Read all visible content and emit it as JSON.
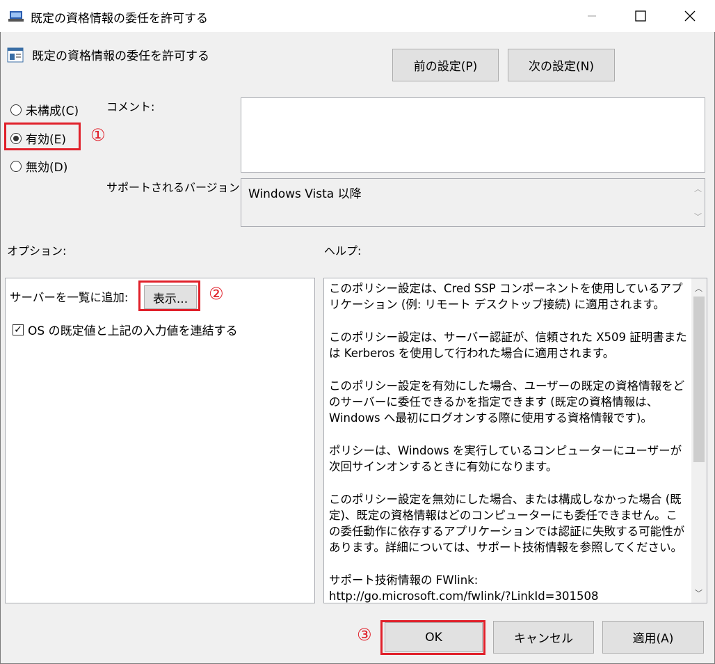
{
  "window": {
    "title": "既定の資格情報の委任を許可する",
    "minimize_icon": "minimize-icon",
    "maximize_icon": "maximize-icon",
    "close_icon": "close-icon"
  },
  "header": {
    "policy_title": "既定の資格情報の委任を許可する",
    "prev_button": "前の設定(P)",
    "next_button": "次の設定(N)"
  },
  "state": {
    "not_configured": "未構成(C)",
    "enabled": "有効(E)",
    "disabled": "無効(D)",
    "selected": "enabled"
  },
  "comment": {
    "label": "コメント:",
    "value": ""
  },
  "supported": {
    "label": "サポートされるバージョン:",
    "value": "Windows Vista 以降"
  },
  "options": {
    "label": "オプション:",
    "server_list_label": "サーバーを一覧に追加:",
    "show_button": "表示...",
    "concat_checkbox_label": "OS の既定値と上記の入力値を連結する",
    "concat_checked": true
  },
  "help": {
    "label": "ヘルプ:",
    "paragraphs": [
      "このポリシー設定は、Cred SSP コンポーネントを使用しているアプリケーション (例: リモート デスクトップ接続) に適用されます。",
      "このポリシー設定は、サーバー認証が、信頼された X509 証明書または Kerberos を使用して行われた場合に適用されます。",
      "このポリシー設定を有効にした場合、ユーザーの既定の資格情報をどのサーバーに委任できるかを指定できます (既定の資格情報は、Windows へ最初にログオンする際に使用する資格情報です)。",
      "ポリシーは、Windows を実行しているコンピューターにユーザーが次回サインオンするときに有効になります。",
      "このポリシー設定を無効にした場合、または構成しなかった場合 (既定)、既定の資格情報はどのコンピューターにも委任できません。この委任動作に依存するアプリケーションでは認証に失敗する可能性があります。詳細については、サポート技術情報を参照してください。",
      "サポート技術情報の FWlink:\nhttp://go.microsoft.com/fwlink/?LinkId=301508"
    ]
  },
  "footer": {
    "ok": "OK",
    "cancel": "キャンセル",
    "apply": "適用(A)"
  },
  "annotations": {
    "m1": "①",
    "m2": "②",
    "m3": "③",
    "color": "#e0202a"
  }
}
